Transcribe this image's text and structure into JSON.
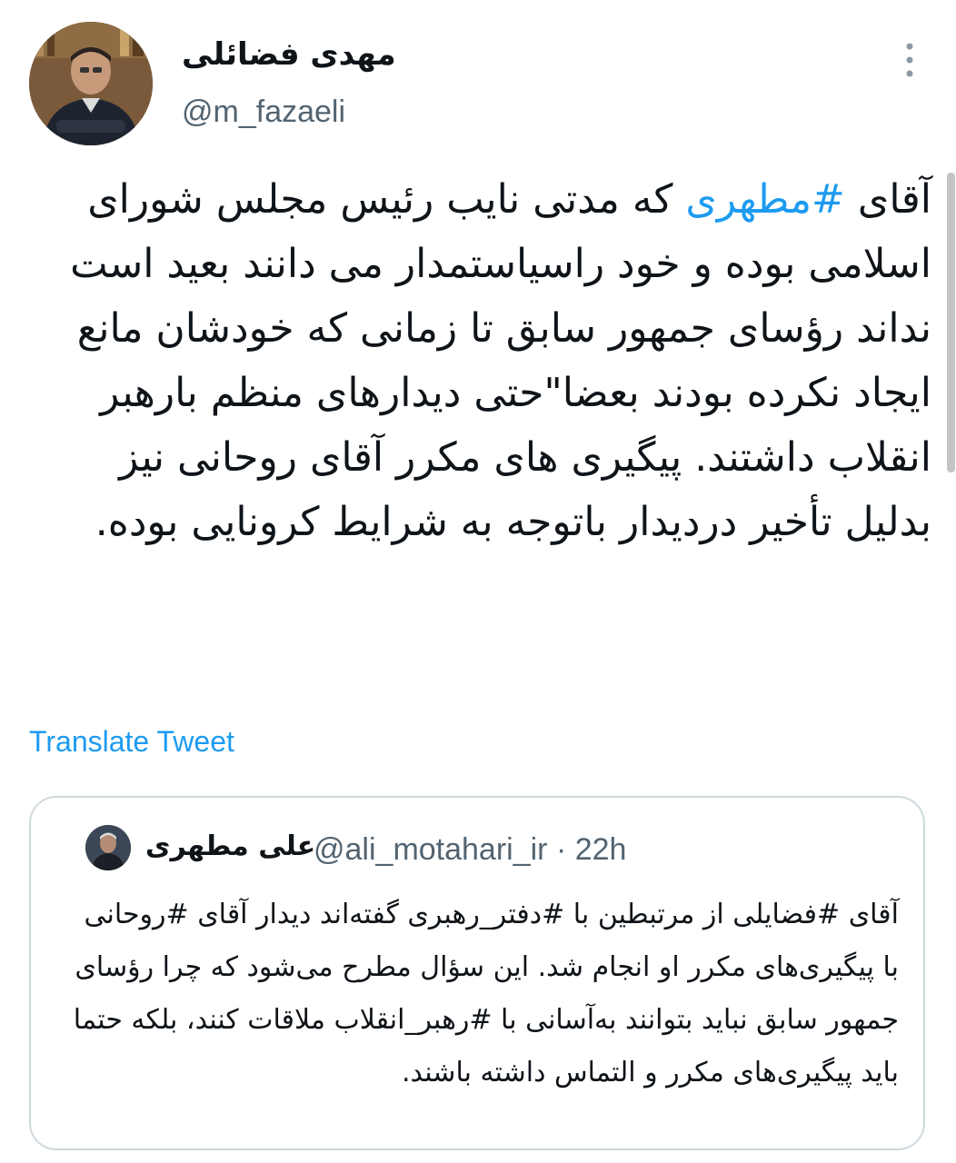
{
  "author": {
    "display_name": "مهدی فضائلی",
    "handle": "@m_fazaeli"
  },
  "tweet": {
    "part1": "آقای ",
    "hashtag": "#مطهری",
    "part2": " که مدتی نایب رئیس مجلس شورای اسلامی بوده و خود راسیاستمدار می دانند بعید است نداند رؤسای جمهور سابق تا زمانی که خودشان مانع ایجاد نکرده بودند بعضا\"حتی دیدارهای منظم بارهبر انقلاب داشتند. پیگیری های مکرر آقای روحانی نیز بدلیل تأخیر دردیدار باتوجه به شرایط کرونایی بوده."
  },
  "translate_label": "Translate Tweet",
  "quoted": {
    "display_name": "علی مطهری",
    "handle_time": "@ali_motahari_ir · 22h",
    "text": "آقای #فضایلی از مرتبطین با #دفتر_رهبری گفته‌اند دیدار آقای #روحانی با پیگیری‌های مکرر او انجام شد. این سؤال مطرح می‌شود که چرا رؤسای جمهور سابق نباید بتوانند به‌آسانی با #رهبر_انقلاب ملاقات کنند، بلکه حتما باید پیگیری‌های مکرر و التماس داشته باشند."
  },
  "colors": {
    "link": "#1d9bf0",
    "secondary_text": "#536471",
    "border": "#cfd9de"
  },
  "icons": {
    "more": "more-vertical-icon"
  }
}
